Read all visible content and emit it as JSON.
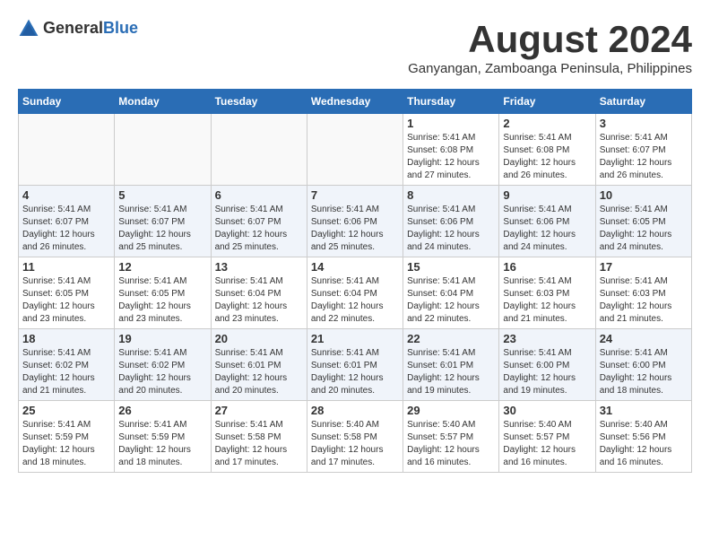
{
  "header": {
    "logo_general": "General",
    "logo_blue": "Blue",
    "month_title": "August 2024",
    "subtitle": "Ganyangan, Zamboanga Peninsula, Philippines"
  },
  "days_of_week": [
    "Sunday",
    "Monday",
    "Tuesday",
    "Wednesday",
    "Thursday",
    "Friday",
    "Saturday"
  ],
  "weeks": [
    [
      {
        "day": "",
        "info": ""
      },
      {
        "day": "",
        "info": ""
      },
      {
        "day": "",
        "info": ""
      },
      {
        "day": "",
        "info": ""
      },
      {
        "day": "1",
        "info": "Sunrise: 5:41 AM\nSunset: 6:08 PM\nDaylight: 12 hours\nand 27 minutes."
      },
      {
        "day": "2",
        "info": "Sunrise: 5:41 AM\nSunset: 6:08 PM\nDaylight: 12 hours\nand 26 minutes."
      },
      {
        "day": "3",
        "info": "Sunrise: 5:41 AM\nSunset: 6:07 PM\nDaylight: 12 hours\nand 26 minutes."
      }
    ],
    [
      {
        "day": "4",
        "info": "Sunrise: 5:41 AM\nSunset: 6:07 PM\nDaylight: 12 hours\nand 26 minutes."
      },
      {
        "day": "5",
        "info": "Sunrise: 5:41 AM\nSunset: 6:07 PM\nDaylight: 12 hours\nand 25 minutes."
      },
      {
        "day": "6",
        "info": "Sunrise: 5:41 AM\nSunset: 6:07 PM\nDaylight: 12 hours\nand 25 minutes."
      },
      {
        "day": "7",
        "info": "Sunrise: 5:41 AM\nSunset: 6:06 PM\nDaylight: 12 hours\nand 25 minutes."
      },
      {
        "day": "8",
        "info": "Sunrise: 5:41 AM\nSunset: 6:06 PM\nDaylight: 12 hours\nand 24 minutes."
      },
      {
        "day": "9",
        "info": "Sunrise: 5:41 AM\nSunset: 6:06 PM\nDaylight: 12 hours\nand 24 minutes."
      },
      {
        "day": "10",
        "info": "Sunrise: 5:41 AM\nSunset: 6:05 PM\nDaylight: 12 hours\nand 24 minutes."
      }
    ],
    [
      {
        "day": "11",
        "info": "Sunrise: 5:41 AM\nSunset: 6:05 PM\nDaylight: 12 hours\nand 23 minutes."
      },
      {
        "day": "12",
        "info": "Sunrise: 5:41 AM\nSunset: 6:05 PM\nDaylight: 12 hours\nand 23 minutes."
      },
      {
        "day": "13",
        "info": "Sunrise: 5:41 AM\nSunset: 6:04 PM\nDaylight: 12 hours\nand 23 minutes."
      },
      {
        "day": "14",
        "info": "Sunrise: 5:41 AM\nSunset: 6:04 PM\nDaylight: 12 hours\nand 22 minutes."
      },
      {
        "day": "15",
        "info": "Sunrise: 5:41 AM\nSunset: 6:04 PM\nDaylight: 12 hours\nand 22 minutes."
      },
      {
        "day": "16",
        "info": "Sunrise: 5:41 AM\nSunset: 6:03 PM\nDaylight: 12 hours\nand 21 minutes."
      },
      {
        "day": "17",
        "info": "Sunrise: 5:41 AM\nSunset: 6:03 PM\nDaylight: 12 hours\nand 21 minutes."
      }
    ],
    [
      {
        "day": "18",
        "info": "Sunrise: 5:41 AM\nSunset: 6:02 PM\nDaylight: 12 hours\nand 21 minutes."
      },
      {
        "day": "19",
        "info": "Sunrise: 5:41 AM\nSunset: 6:02 PM\nDaylight: 12 hours\nand 20 minutes."
      },
      {
        "day": "20",
        "info": "Sunrise: 5:41 AM\nSunset: 6:01 PM\nDaylight: 12 hours\nand 20 minutes."
      },
      {
        "day": "21",
        "info": "Sunrise: 5:41 AM\nSunset: 6:01 PM\nDaylight: 12 hours\nand 20 minutes."
      },
      {
        "day": "22",
        "info": "Sunrise: 5:41 AM\nSunset: 6:01 PM\nDaylight: 12 hours\nand 19 minutes."
      },
      {
        "day": "23",
        "info": "Sunrise: 5:41 AM\nSunset: 6:00 PM\nDaylight: 12 hours\nand 19 minutes."
      },
      {
        "day": "24",
        "info": "Sunrise: 5:41 AM\nSunset: 6:00 PM\nDaylight: 12 hours\nand 18 minutes."
      }
    ],
    [
      {
        "day": "25",
        "info": "Sunrise: 5:41 AM\nSunset: 5:59 PM\nDaylight: 12 hours\nand 18 minutes."
      },
      {
        "day": "26",
        "info": "Sunrise: 5:41 AM\nSunset: 5:59 PM\nDaylight: 12 hours\nand 18 minutes."
      },
      {
        "day": "27",
        "info": "Sunrise: 5:41 AM\nSunset: 5:58 PM\nDaylight: 12 hours\nand 17 minutes."
      },
      {
        "day": "28",
        "info": "Sunrise: 5:40 AM\nSunset: 5:58 PM\nDaylight: 12 hours\nand 17 minutes."
      },
      {
        "day": "29",
        "info": "Sunrise: 5:40 AM\nSunset: 5:57 PM\nDaylight: 12 hours\nand 16 minutes."
      },
      {
        "day": "30",
        "info": "Sunrise: 5:40 AM\nSunset: 5:57 PM\nDaylight: 12 hours\nand 16 minutes."
      },
      {
        "day": "31",
        "info": "Sunrise: 5:40 AM\nSunset: 5:56 PM\nDaylight: 12 hours\nand 16 minutes."
      }
    ]
  ]
}
